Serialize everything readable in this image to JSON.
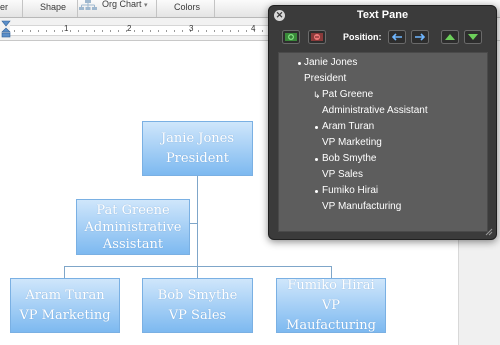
{
  "ribbon": {
    "tab_partial": "er",
    "shape_label": "Shape",
    "orgchart_label": "Org Chart",
    "orgchart_caret": "▾",
    "colors_label": "Colors"
  },
  "ruler": {
    "numbers": [
      "1",
      "2",
      "3",
      "4"
    ]
  },
  "chart": {
    "top": {
      "name": "Janie Jones",
      "title": "President"
    },
    "assistant": {
      "name": "Pat Greene",
      "title_line1": "Administrative",
      "title_line2": "Assistant"
    },
    "reports": [
      {
        "name": "Aram Turan",
        "title": "VP Marketing"
      },
      {
        "name": "Bob Smythe",
        "title": "VP Sales"
      },
      {
        "name": "Fumiko Hirai",
        "title": "VP Maufacturing"
      }
    ]
  },
  "text_pane": {
    "title": "Text Pane",
    "close_glyph": "✕",
    "position_label": "Position:",
    "entries": [
      {
        "name": "Janie Jones",
        "title": "President",
        "marker": "bullet"
      },
      {
        "name": "Pat Greene",
        "title": "Administrative Assistant",
        "marker": "assistant",
        "marker_glyph": "↳"
      },
      {
        "name": "Aram Turan",
        "title": "VP Marketing",
        "marker": "bullet"
      },
      {
        "name": "Bob Smythe",
        "title": "VP Sales",
        "marker": "bullet"
      },
      {
        "name": "Fumiko Hirai",
        "title": "VP Manufacturing",
        "marker": "bullet"
      }
    ]
  },
  "colors": {
    "node_top": "#cfe6fb",
    "node_bottom": "#7db9f0",
    "connector": "#7fa6c9",
    "pane_bg": "#3b3b3b",
    "pane_body": "#5d5d5d"
  },
  "icons": [
    "org-chart-icon",
    "indent-marker-icon",
    "close-icon",
    "add-shape-icon",
    "delete-shape-icon",
    "promote-icon",
    "demote-icon",
    "move-up-icon",
    "move-down-icon",
    "resize-grip-icon"
  ]
}
